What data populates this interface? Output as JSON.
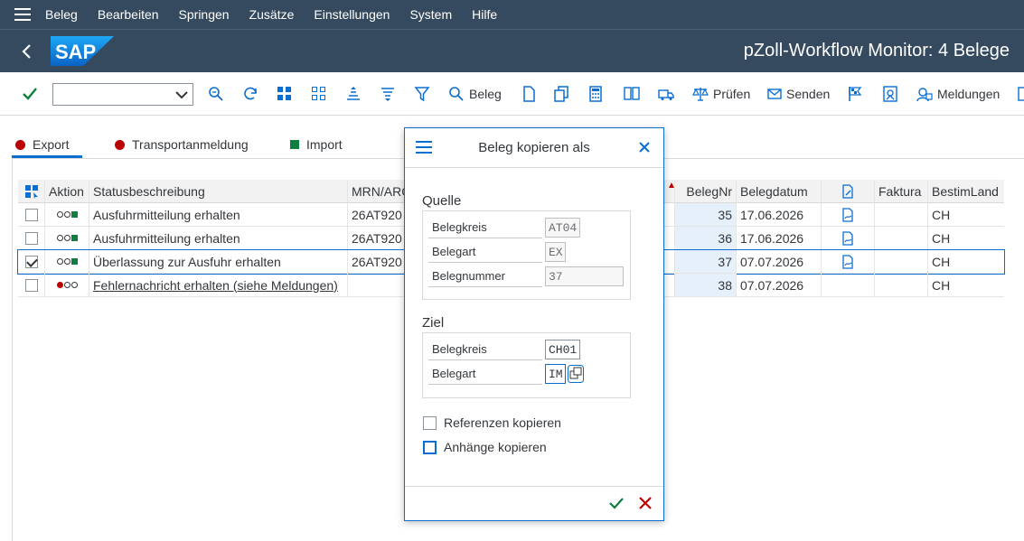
{
  "menu": {
    "items": [
      "Beleg",
      "Bearbeiten",
      "Springen",
      "Zusätze",
      "Einstellungen",
      "System",
      "Hilfe"
    ]
  },
  "titlebar": {
    "logo_text": "SAP",
    "title": "pZoll-Workflow Monitor: 4 Belege"
  },
  "toolbar": {
    "command_field_value": "",
    "beleg_label": "Beleg",
    "pruefen_label": "Prüfen",
    "senden_label": "Senden",
    "meldungen_label": "Meldungen"
  },
  "tabs": {
    "export": "Export",
    "transport": "Transportanmeldung",
    "import": "Import"
  },
  "table": {
    "headers": {
      "aktion": "Aktion",
      "status": "Statusbeschreibung",
      "mrn": "MRN/ARC",
      "belegnr": "BelegNr",
      "belegdatum": "Belegdatum",
      "faktura": "Faktura",
      "bestimland": "BestimLand"
    },
    "rows": [
      {
        "status": "Ausfuhrmitteilung erhalten",
        "mrn": "26AT920",
        "belegnr": "35",
        "belegdatum": "17.06.2026",
        "bestimland": "CH",
        "checked": false
      },
      {
        "status": "Ausfuhrmitteilung erhalten",
        "mrn": "26AT920",
        "belegnr": "36",
        "belegdatum": "17.06.2026",
        "bestimland": "CH",
        "checked": false
      },
      {
        "status": "Überlassung zur Ausfuhr erhalten",
        "mrn": "26AT920",
        "belegnr": "37",
        "belegdatum": "07.07.2026",
        "bestimland": "CH",
        "checked": true
      },
      {
        "status": "Fehlernachricht erhalten (siehe Meldungen)",
        "mrn": "",
        "belegnr": "38",
        "belegdatum": "07.07.2026",
        "bestimland": "CH",
        "checked": false
      }
    ]
  },
  "dialog": {
    "title": "Beleg kopieren als",
    "quelle": {
      "heading": "Quelle",
      "belegkreis_label": "Belegkreis",
      "belegkreis_value": "AT04",
      "belegart_label": "Belegart",
      "belegart_value": "EX",
      "belegnummer_label": "Belegnummer",
      "belegnummer_value": "37"
    },
    "ziel": {
      "heading": "Ziel",
      "belegkreis_label": "Belegkreis",
      "belegkreis_value": "CH01",
      "belegart_label": "Belegart",
      "belegart_value": "IM"
    },
    "referenzen_label": "Referenzen kopieren",
    "anhaenge_label": "Anhänge kopieren"
  },
  "colors": {
    "shell": "#354a5f",
    "accent": "#0a6ed1",
    "error": "#bb0000",
    "success": "#107e3e"
  }
}
